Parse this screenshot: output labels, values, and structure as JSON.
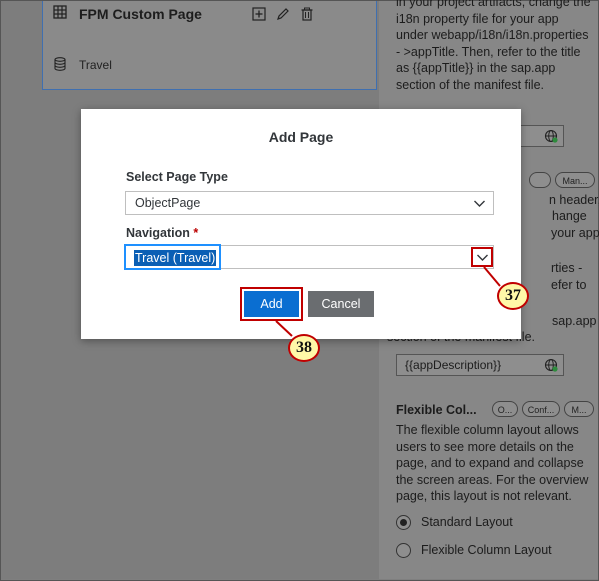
{
  "canvas": {
    "card": {
      "title": "FPM Custom Page",
      "entity": "Travel",
      "icons": [
        "table-icon",
        "add-icon",
        "edit-icon",
        "delete-icon",
        "database-icon"
      ]
    }
  },
  "right_panel": {
    "title_help": "in your project artifacts, change the i18n property file for your app under webapp/i18n/i18n.properties - >appTitle. Then, refer to the title as {{appTitle}} in the sap.app section of the manifest file.",
    "description_pills": [
      "",
      "Man..."
    ],
    "description_help_fragments": [
      "n header,",
      "hange",
      "your app",
      "rties -",
      "efer to",
      "sap.app"
    ],
    "description_help_tail": "section of the manifest file.",
    "description_value": "{{appDescription}}",
    "flexible_label": "Flexible Col...",
    "flexible_pills": [
      "O...",
      "Conf...",
      "M..."
    ],
    "flexible_help": "The flexible column layout allows users to see more details on the page, and to expand and collapse the screen areas. For the overview page, this layout is not relevant.",
    "layouts": [
      {
        "label": "Standard Layout",
        "checked": true
      },
      {
        "label": "Flexible Column Layout",
        "checked": false
      }
    ]
  },
  "dialog": {
    "title": "Add Page",
    "page_type_label": "Select Page Type",
    "page_type_value": "ObjectPage",
    "navigation_label": "Navigation",
    "navigation_required_mark": "*",
    "navigation_value": "Travel (Travel)",
    "add_label": "Add",
    "cancel_label": "Cancel"
  },
  "callouts": {
    "dropdown": "37",
    "add": "38"
  },
  "colors": {
    "accent": "#0a6ed1",
    "annotation_red": "#c00000",
    "callout_fill": "#fff8a8",
    "focus": "#1e90ff"
  }
}
